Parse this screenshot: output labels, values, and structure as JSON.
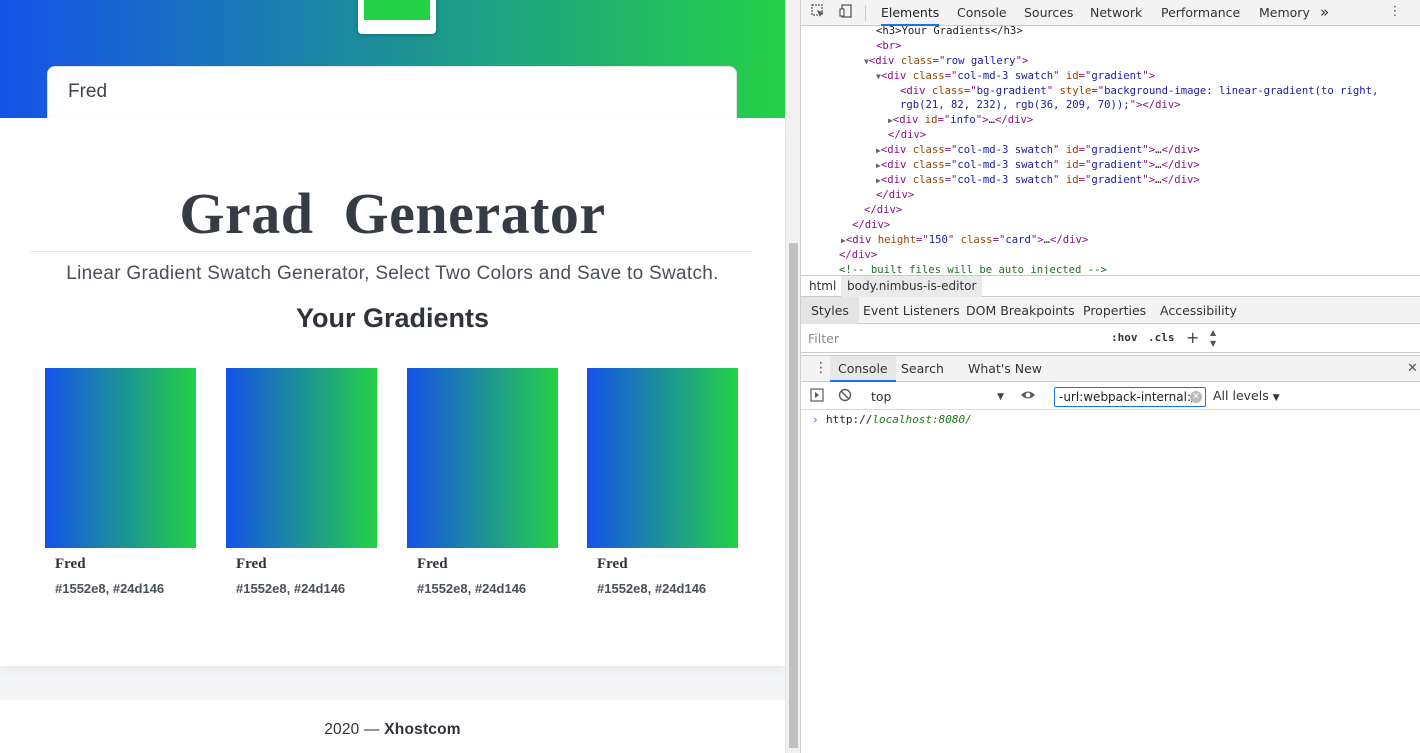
{
  "page": {
    "name_input_value": "Fred",
    "title": "Grad  Generator",
    "subtitle": "Linear Gradient Swatch Generator, Select Two Colors and Save to Swatch.",
    "gallery_heading": "Your Gradients",
    "colors": {
      "from": "#1552e8",
      "to": "#24d146"
    },
    "swatches": [
      {
        "name": "Fred",
        "hex": "#1552e8, #24d146"
      },
      {
        "name": "Fred",
        "hex": "#1552e8, #24d146"
      },
      {
        "name": "Fred",
        "hex": "#1552e8, #24d146"
      },
      {
        "name": "Fred",
        "hex": "#1552e8, #24d146"
      }
    ],
    "footer": {
      "year": "2020",
      "dash": "—",
      "brand": "Xhostcom"
    }
  },
  "devtools": {
    "tabs": [
      "Elements",
      "Console",
      "Sources",
      "Network",
      "Performance",
      "Memory"
    ],
    "more_tabs": "»",
    "tree": {
      "l1": "<h3>Your Gradients</h3>",
      "l2": "<br>",
      "l3_tag": "div",
      "l3_attr": "class",
      "l3_val": "row gallery",
      "l4_tag": "div",
      "l4_attr1": "class",
      "l4_val1": "col-md-3 swatch",
      "l4_attr2": "id",
      "l4_val2": "gradient",
      "l5_tag": "div",
      "l5_attr1": "class",
      "l5_val1": "bg-gradient",
      "l5_attr2": "style",
      "l5_val2a": "background-image: linear-gradient(to right,",
      "l5_val2b": "rgb(21, 82, 232), rgb(36, 209, 70));",
      "l6_tag": "div",
      "l6_attr": "id",
      "l6_val": "info",
      "ellipsis": "…",
      "close_div": "</div>",
      "collapsed_rows": [
        {
          "val1": "col-md-3 swatch",
          "val2": "gradient"
        },
        {
          "val1": "col-md-3 swatch",
          "val2": "gradient"
        },
        {
          "val1": "col-md-3 swatch",
          "val2": "gradient"
        }
      ],
      "card_attr1": "height",
      "card_val1": "150",
      "card_attr2": "class",
      "card_val2": "card",
      "comment": "<!-- built files will be auto injected -->"
    },
    "breadcrumb": [
      "html",
      "body.nimbus-is-editor"
    ],
    "styles_tabs": [
      "Styles",
      "Event Listeners",
      "DOM Breakpoints",
      "Properties",
      "Accessibility"
    ],
    "styles_filter_placeholder": "Filter",
    "hov": ":hov",
    "cls": ".cls",
    "drawer_tabs": [
      "Console",
      "Search",
      "What's New"
    ],
    "console": {
      "context": "top",
      "filter_value": "-url:webpack-internal://",
      "levels": "All levels",
      "output_prefix": "http://",
      "output_host": "localhost:8080/"
    }
  }
}
